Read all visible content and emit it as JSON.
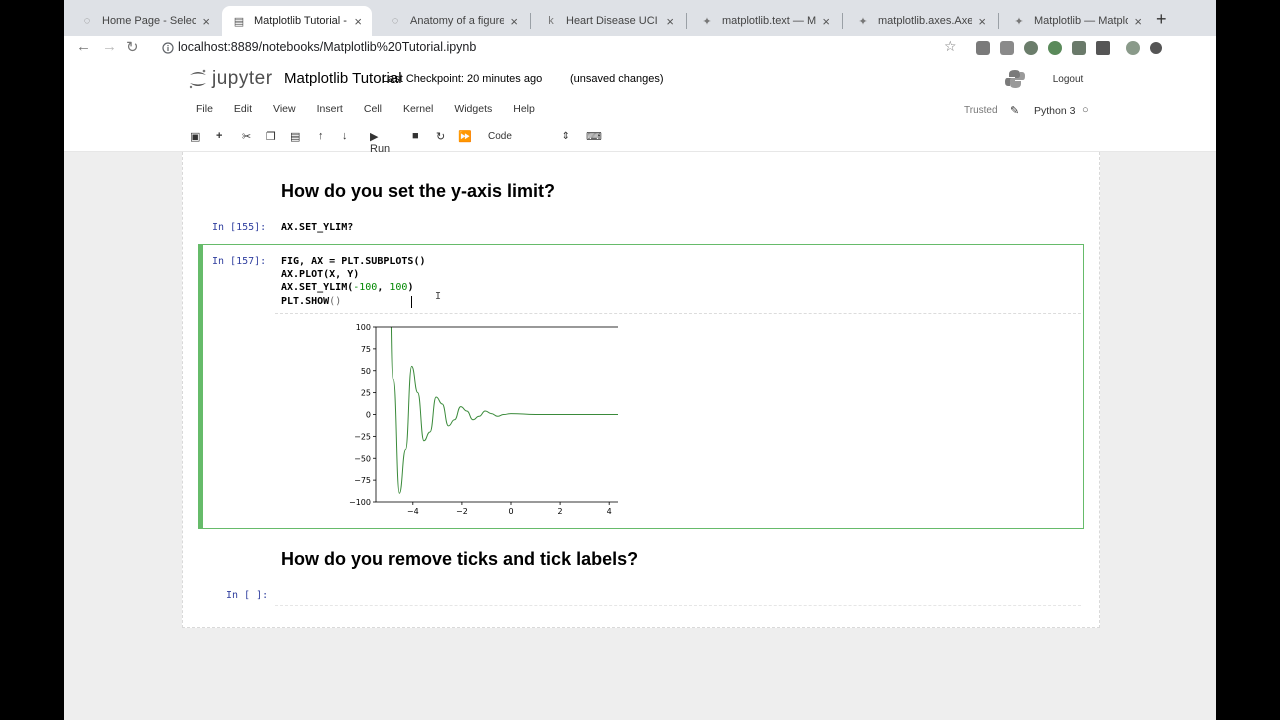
{
  "browser": {
    "tabs": [
      {
        "label": "Home Page - Select o"
      },
      {
        "label": "Matplotlib Tutorial - J"
      },
      {
        "label": "Anatomy of a figure —"
      },
      {
        "label": "Heart Disease UCI | K"
      },
      {
        "label": "matplotlib.text — Mat"
      },
      {
        "label": "matplotlib.axes.Axes."
      },
      {
        "label": "Matplotlib — Matplotl"
      }
    ],
    "url": "localhost:8889/notebooks/Matplotlib%20Tutorial.ipynb"
  },
  "jupyter": {
    "logo": "jupyter",
    "title": "Matplotlib Tutorial",
    "checkpoint": "Last Checkpoint: 20 minutes ago",
    "unsaved": "(unsaved changes)",
    "logout": "Logout",
    "menu": [
      "File",
      "Edit",
      "View",
      "Insert",
      "Cell",
      "Kernel",
      "Widgets",
      "Help"
    ],
    "trusted": "Trusted",
    "kernel": "Python 3",
    "toolbar": {
      "run": "Run",
      "cell_type": "Code"
    }
  },
  "notebook": {
    "heading1": "How do you set the y-axis limit?",
    "cell1": {
      "prompt": "In [155]:",
      "code": "AX.SET_YLIM?"
    },
    "cell2": {
      "prompt": "In [157]:",
      "line1": "FIG, AX = PLT.SUBPLOTS()",
      "line2": "AX.PLOT(X, Y)",
      "line3a": "AX.SET_YLIM(",
      "line3b": "-100",
      "line3c": ", ",
      "line3d": "100",
      "line3e": ")",
      "line4a": "PLT.SHOW",
      "line4b": "()"
    },
    "heading2": "How do you remove ticks and tick labels?",
    "cell3": {
      "prompt": "In [ ]:"
    }
  },
  "chart_data": {
    "type": "line",
    "title": "",
    "xlabel": "",
    "ylabel": "",
    "xlim": [
      -5.5,
      5.5
    ],
    "ylim": [
      -100,
      100
    ],
    "xticks": [
      "−4",
      "−2",
      "0",
      "2",
      "4"
    ],
    "xtick_values": [
      -4,
      -2,
      0,
      2,
      4
    ],
    "yticks": [
      "100",
      "75",
      "50",
      "25",
      "0",
      "−25",
      "−50",
      "−75",
      "−100"
    ],
    "ytick_values": [
      100,
      75,
      50,
      25,
      0,
      -25,
      -50,
      -75,
      -100
    ],
    "series": [
      {
        "color": "#3a8a3a",
        "x": [
          -5.0,
          -4.8,
          -4.55,
          -4.3,
          -4.05,
          -3.8,
          -3.55,
          -3.3,
          -3.05,
          -2.8,
          -2.55,
          -2.3,
          -2.05,
          -1.8,
          -1.55,
          -1.3,
          -1.05,
          -0.8,
          -0.55,
          -0.3,
          0,
          1,
          2,
          3,
          4,
          5
        ],
        "y": [
          300,
          40,
          -90,
          -40,
          55,
          25,
          -30,
          -20,
          20,
          12,
          -13,
          -6,
          9,
          4,
          -6,
          -2,
          4,
          1,
          -2,
          0,
          1,
          0,
          0,
          0,
          0,
          0
        ]
      }
    ],
    "grid": false
  }
}
